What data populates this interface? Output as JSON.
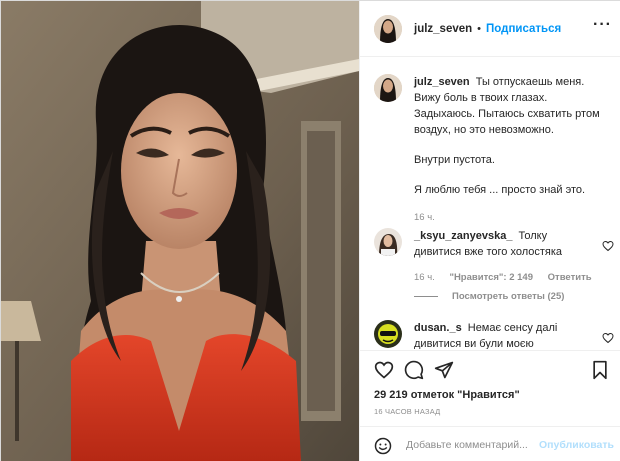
{
  "post": {
    "username": "julz_seven",
    "separator": "•",
    "follow_label": "Подписаться",
    "more_label": "...",
    "caption": {
      "username": "julz_seven",
      "lines": [
        "Ты отпускаешь меня.",
        "Вижу боль в твоих глазах.",
        "Задыхаюсь. Пытаюсь схватить ртом",
        "воздух, но это невозможно.",
        "Внутри пустота.",
        "Я люблю тебя ... просто знай это."
      ],
      "time": "16 ч."
    },
    "comments": [
      {
        "username": "_ksyu_zanyevska_",
        "text": "Толку дивитися вже того холостяка",
        "time": "16 ч.",
        "likes": "\"Нравится\": 2 149",
        "reply_label": "Ответить",
        "view_replies": "Посмотреть ответы (25)"
      },
      {
        "username": "dusan._s",
        "text": "Немає сенсу далі дивитися ви були моєю",
        "time": "",
        "likes": "",
        "reply_label": ""
      }
    ],
    "likes_count": "29 219 отметок \"Нравится\"",
    "posted_ago": "16 ЧАСОВ НАЗАД",
    "comment_input": {
      "placeholder": "Добавьте комментарий...",
      "value": ""
    },
    "publish_label": "Опубликовать",
    "icons": {
      "like": "heart-icon",
      "comment": "comment-icon",
      "share": "paper-plane-icon",
      "save": "bookmark-icon",
      "emoji": "smiley-icon",
      "comment_like": "heart-icon"
    },
    "colors": {
      "accent": "#0095f6",
      "publish_disabled": "#b2dffc",
      "secondary_text": "#8e8e8e",
      "dress": "#d3351f"
    }
  }
}
